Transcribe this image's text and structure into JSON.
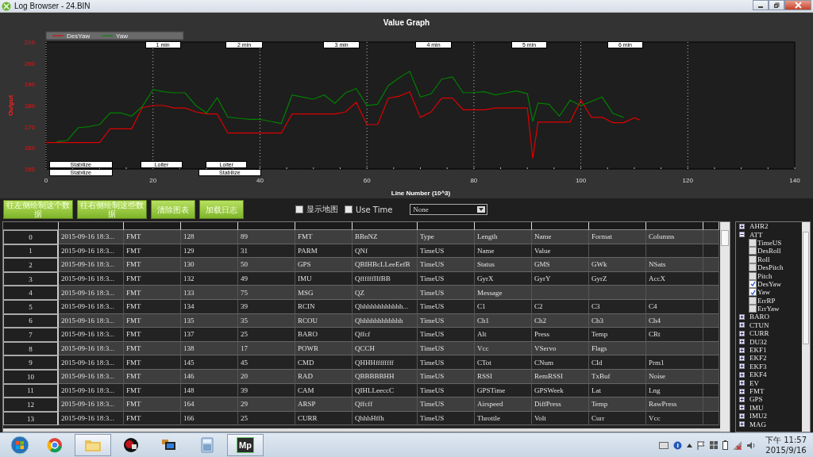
{
  "window": {
    "title": "Log Browser - 24.BIN"
  },
  "graph": {
    "chart_data": {
      "type": "line",
      "title": "Value Graph",
      "xlabel": "Line Number (10^3)",
      "ylabel": "Output",
      "xlim": [
        0,
        140
      ],
      "ylim": [
        150,
        210
      ],
      "xticks": [
        0,
        20,
        40,
        60,
        80,
        100,
        120,
        140
      ],
      "yticks": [
        150,
        160,
        170,
        180,
        190,
        200,
        210
      ],
      "x": [
        0,
        2,
        4,
        6,
        8,
        10,
        12,
        14,
        16,
        18,
        20,
        22,
        24,
        26,
        28,
        30,
        32,
        34,
        36,
        38,
        40,
        42,
        44,
        46,
        48,
        50,
        52,
        54,
        56,
        58,
        60,
        62,
        64,
        66,
        68,
        70,
        72,
        74,
        76,
        78,
        80,
        82,
        84,
        86,
        88,
        90,
        91,
        92,
        94,
        96,
        98,
        100,
        102,
        104,
        106,
        108,
        110,
        111
      ],
      "series": [
        {
          "name": "DesYaw",
          "color": "#e00000",
          "values": [
            162.5,
            162.5,
            162.5,
            162.5,
            162.5,
            162.5,
            169,
            169,
            169,
            179,
            180,
            180,
            178.8,
            178.8,
            177,
            176,
            176,
            167,
            167,
            167,
            167,
            167,
            167,
            176,
            176,
            176,
            176,
            176,
            177,
            181.5,
            171,
            171,
            183.5,
            184.4,
            186.5,
            174.4,
            177,
            183.5,
            183.5,
            178,
            178,
            178,
            178.8,
            178.8,
            178.8,
            178.8,
            155,
            172.2,
            172.2,
            172.2,
            172.2,
            182.5,
            174.4,
            174.4,
            171.9,
            171.9,
            174.2,
            173.2
          ]
        },
        {
          "name": "Yaw",
          "color": "#008000",
          "values": [
            null,
            162.9,
            163.5,
            169.5,
            170,
            171,
            176.5,
            176.5,
            175,
            179.5,
            187.5,
            186.5,
            186,
            186,
            180,
            176.5,
            183.7,
            174.5,
            174,
            173.5,
            173.5,
            172.5,
            171.5,
            185,
            184,
            183,
            185,
            181,
            186,
            188,
            180,
            180.6,
            189.4,
            193,
            196.2,
            184,
            185.5,
            192.5,
            193.5,
            186,
            186.2,
            186.5,
            185,
            186,
            186.9,
            185.6,
            172.5,
            181.2,
            180.6,
            175,
            182.5,
            180,
            182,
            184,
            176.2,
            174.4,
            null,
            null
          ]
        }
      ],
      "grid": true,
      "legend": "top-left",
      "annotations": [
        "1 min",
        "2 min",
        "3 min",
        "4 min",
        "5 min",
        "6 min"
      ]
    },
    "mode_labels": [
      "Stabilize",
      "Loiter",
      "Loiter",
      "Stabilize",
      "Stabilize"
    ]
  },
  "toolbar": {
    "buttons": [
      "往左侧绘制这个数据",
      "往右侧绘制这些数据",
      "清除图表",
      "加载日志"
    ],
    "checkboxes": [
      {
        "label": "显示地图",
        "checked": false
      },
      {
        "label": "Use Time",
        "checked": false
      }
    ],
    "dropdown": {
      "value": "None"
    }
  },
  "table": {
    "rows": [
      {
        "header": "0",
        "cells": [
          "2015-09-16 18:3...",
          "FMT",
          "128",
          "89",
          "FMT",
          "BBnNZ",
          "Type",
          "Length",
          "Name",
          "Format",
          "Columns"
        ]
      },
      {
        "header": "1",
        "cells": [
          "2015-09-16 18:3...",
          "FMT",
          "129",
          "31",
          "PARM",
          "QNf",
          "TimeUS",
          "Name",
          "Value"
        ]
      },
      {
        "header": "2",
        "cells": [
          "2015-09-16 18:3...",
          "FMT",
          "130",
          "50",
          "GPS",
          "QBIHBcLLeeEefB",
          "TimeUS",
          "Status",
          "GMS",
          "GWk",
          "NSats"
        ]
      },
      {
        "header": "3",
        "cells": [
          "2015-09-16 18:3...",
          "FMT",
          "132",
          "49",
          "IMU",
          "QffffffIIfBB",
          "TimeUS",
          "GyrX",
          "GyrY",
          "GyrZ",
          "AccX"
        ]
      },
      {
        "header": "4",
        "cells": [
          "2015-09-16 18:3...",
          "FMT",
          "133",
          "75",
          "MSG",
          "QZ",
          "TimeUS",
          "Message"
        ]
      },
      {
        "header": "5",
        "cells": [
          "2015-09-16 18:3...",
          "FMT",
          "134",
          "39",
          "RCIN",
          "Qhhhhhhhhhhhh...",
          "TimeUS",
          "C1",
          "C2",
          "C3",
          "C4"
        ]
      },
      {
        "header": "6",
        "cells": [
          "2015-09-16 18:3...",
          "FMT",
          "135",
          "35",
          "RCOU",
          "Qhhhhhhhhhhhh",
          "TimeUS",
          "Ch1",
          "Ch2",
          "Ch3",
          "Ch4"
        ]
      },
      {
        "header": "7",
        "cells": [
          "2015-09-16 18:3...",
          "FMT",
          "137",
          "25",
          "BARO",
          "Qffcf",
          "TimeUS",
          "Alt",
          "Press",
          "Temp",
          "CRt"
        ]
      },
      {
        "header": "8",
        "cells": [
          "2015-09-16 18:3...",
          "FMT",
          "138",
          "17",
          "POWR",
          "QCCH",
          "TimeUS",
          "Vcc",
          "VServo",
          "Flags"
        ]
      },
      {
        "header": "9",
        "cells": [
          "2015-09-16 18:3...",
          "FMT",
          "145",
          "45",
          "CMD",
          "QHHHffffffff",
          "TimeUS",
          "CTot",
          "CNum",
          "CId",
          "Prm1"
        ]
      },
      {
        "header": "10",
        "cells": [
          "2015-09-16 18:3...",
          "FMT",
          "146",
          "20",
          "RAD",
          "QBBBBBHH",
          "TimeUS",
          "RSSI",
          "RemRSSI",
          "TxBuf",
          "Noise"
        ]
      },
      {
        "header": "11",
        "cells": [
          "2015-09-16 18:3...",
          "FMT",
          "148",
          "39",
          "CAM",
          "QIHLLeeccC",
          "TimeUS",
          "GPSTime",
          "GPSWeek",
          "Lat",
          "Lng"
        ]
      },
      {
        "header": "12",
        "cells": [
          "2015-09-16 18:3...",
          "FMT",
          "164",
          "29",
          "ARSP",
          "Qffcff",
          "TimeUS",
          "Airspeed",
          "DiffPress",
          "Temp",
          "RawPress"
        ]
      },
      {
        "header": "13",
        "cells": [
          "2015-09-16 18:3...",
          "FMT",
          "166",
          "25",
          "CURR",
          "QhhhHffh",
          "TimeUS",
          "Throttle",
          "Volt",
          "Curr",
          "Vcc"
        ]
      }
    ]
  },
  "tree": [
    {
      "label": "AHR2",
      "expanded": false
    },
    {
      "label": "ATT",
      "expanded": true,
      "children": [
        {
          "label": "TimeUS",
          "checked": false
        },
        {
          "label": "DesRoll",
          "checked": false
        },
        {
          "label": "Roll",
          "checked": false
        },
        {
          "label": "DesPitch",
          "checked": false
        },
        {
          "label": "Pitch",
          "checked": false
        },
        {
          "label": "DesYaw",
          "checked": true
        },
        {
          "label": "Yaw",
          "checked": true
        },
        {
          "label": "ErrRP",
          "checked": false
        },
        {
          "label": "ErrYaw",
          "checked": false
        }
      ]
    },
    {
      "label": "BARO",
      "expanded": false
    },
    {
      "label": "CTUN",
      "expanded": false
    },
    {
      "label": "CURR",
      "expanded": false
    },
    {
      "label": "DU32",
      "expanded": false
    },
    {
      "label": "EKF1",
      "expanded": false
    },
    {
      "label": "EKF2",
      "expanded": false
    },
    {
      "label": "EKF3",
      "expanded": false
    },
    {
      "label": "EKF4",
      "expanded": false
    },
    {
      "label": "EV",
      "expanded": false
    },
    {
      "label": "FMT",
      "expanded": false
    },
    {
      "label": "GPS",
      "expanded": false
    },
    {
      "label": "IMU",
      "expanded": false
    },
    {
      "label": "IMU2",
      "expanded": false
    },
    {
      "label": "MAG",
      "expanded": false
    }
  ],
  "taskbar": {
    "apps": [
      {
        "kind": "start",
        "selected": false
      },
      {
        "kind": "browser",
        "selected": false
      },
      {
        "kind": "folder",
        "selected": true
      },
      {
        "kind": "red-app",
        "selected": false
      },
      {
        "kind": "window-app",
        "selected": false
      },
      {
        "kind": "calculator",
        "selected": false
      },
      {
        "kind": "mp",
        "label": "Mp",
        "selected": true
      }
    ],
    "time": "下午 11:57",
    "date": "2015/9/16"
  }
}
